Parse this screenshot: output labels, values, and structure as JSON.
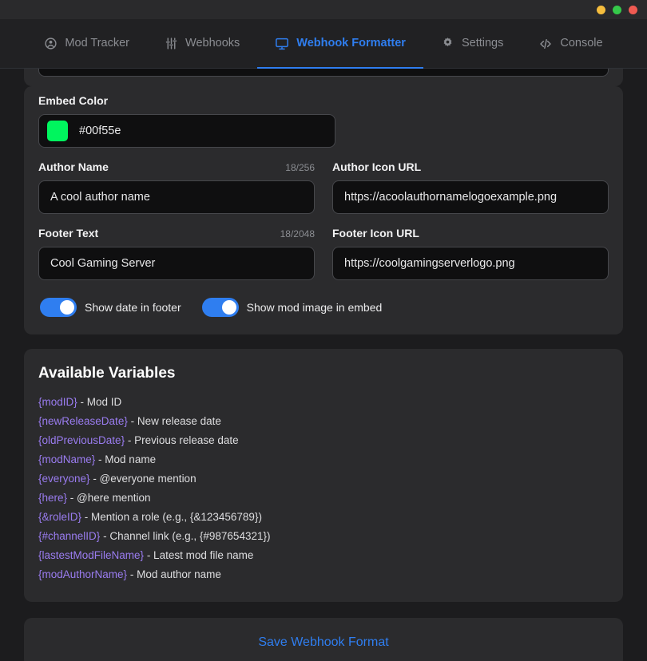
{
  "window": {
    "buttons": [
      {
        "name": "minimize",
        "color": "#f5bd3d"
      },
      {
        "name": "maximize",
        "color": "#35c94a"
      },
      {
        "name": "close",
        "color": "#f05a52"
      }
    ]
  },
  "nav": {
    "tabs": [
      {
        "label": "Mod Tracker",
        "icon": "user-circle-icon",
        "active": false
      },
      {
        "label": "Webhooks",
        "icon": "sliders-icon",
        "active": false
      },
      {
        "label": "Webhook Formatter",
        "icon": "monitor-icon",
        "active": true
      },
      {
        "label": "Settings",
        "icon": "gear-icon",
        "active": false
      },
      {
        "label": "Console",
        "icon": "code-brackets-icon",
        "active": false
      }
    ],
    "active_color": "#2f7ef0"
  },
  "form": {
    "embed_color": {
      "label": "Embed Color",
      "value": "#00f55e",
      "swatch": "#00f55e"
    },
    "author_name": {
      "label": "Author Name",
      "counter": "18/256",
      "value": "A cool author name",
      "placeholder": "A cool author name"
    },
    "author_icon_url": {
      "label": "Author Icon URL",
      "value": "https://acoolauthornamelogoexample.png",
      "placeholder": "https://acoolauthornamelogoexample.png"
    },
    "footer_text": {
      "label": "Footer Text",
      "counter": "18/2048",
      "value": "Cool Gaming Server",
      "placeholder": "Cool Gaming Server"
    },
    "footer_icon_url": {
      "label": "Footer Icon URL",
      "value": "https://coolgamingserverlogo.png",
      "placeholder": "https://coolgamingserverlogo.png"
    },
    "toggles": [
      {
        "label": "Show date in footer",
        "on": true
      },
      {
        "label": "Show mod image in embed",
        "on": true
      }
    ]
  },
  "variables": {
    "title": "Available Variables",
    "items": [
      {
        "name": "{modID}",
        "desc": " - Mod ID"
      },
      {
        "name": "{newReleaseDate}",
        "desc": " - New release date"
      },
      {
        "name": "{oldPreviousDate}",
        "desc": " - Previous release date"
      },
      {
        "name": "{modName}",
        "desc": " - Mod name"
      },
      {
        "name": "{everyone}",
        "desc": " - @everyone mention"
      },
      {
        "name": "{here}",
        "desc": " - @here mention"
      },
      {
        "name": "{&roleID}",
        "desc": " - Mention a role (e.g., {&123456789})"
      },
      {
        "name": "{#channelID}",
        "desc": " - Channel link (e.g., {#987654321})"
      },
      {
        "name": "{lastestModFileName}",
        "desc": " - Latest mod file name"
      },
      {
        "name": "{modAuthorName}",
        "desc": " - Mod author name"
      }
    ],
    "name_color": "#9a7cf0"
  },
  "save": {
    "label": "Save Webhook Format"
  }
}
